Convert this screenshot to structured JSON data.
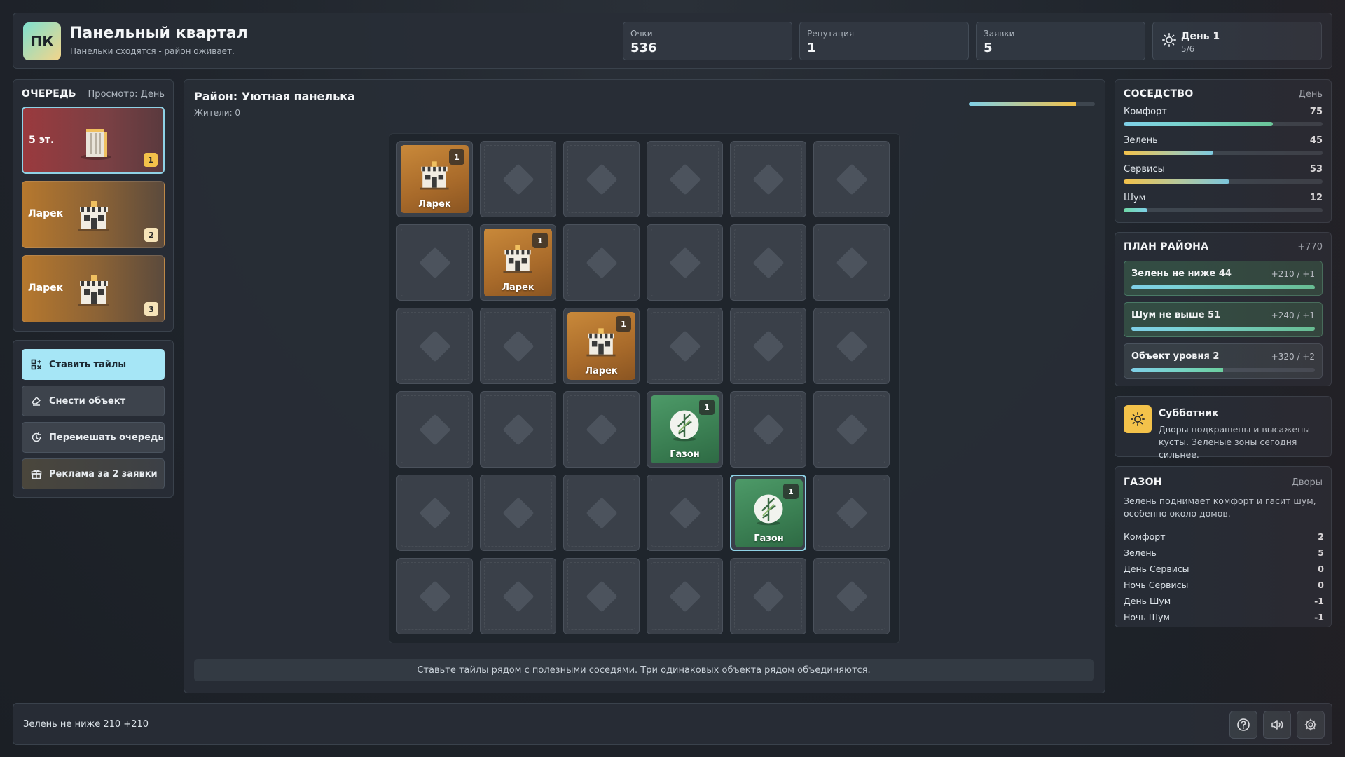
{
  "app": {
    "logo": "ПК",
    "title": "Панельный квартал",
    "subtitle": "Панельки сходятся - район оживает."
  },
  "stats": {
    "score_label": "Очки",
    "score": "536",
    "reputation_label": "Репутация",
    "reputation": "1",
    "requests_label": "Заявки",
    "requests": "5",
    "day_label": "День 1",
    "day_progress": "5/6",
    "day_icon": "sun-icon"
  },
  "queue": {
    "title": "ОЧЕРЕДЬ",
    "view": "Просмотр: День",
    "items": [
      {
        "name": "5 эт.",
        "num": "1",
        "kind": "building"
      },
      {
        "name": "Ларек",
        "num": "2",
        "kind": "kiosk"
      },
      {
        "name": "Ларек",
        "num": "3",
        "kind": "kiosk"
      }
    ]
  },
  "actions": {
    "place": "Ставить тайлы",
    "demolish": "Снести объект",
    "shuffle": "Перемешать очередь",
    "ad": "Реклама за 2 заявки"
  },
  "board": {
    "district": "Район: Уютная панелька",
    "residents": "Жители: 0",
    "top_progress": 0.85,
    "hint": "Ставьте тайлы рядом с полезными соседями. Три одинаковых объекта рядом объединяются.",
    "tiles": [
      {
        "row": 0,
        "col": 0,
        "name": "Ларек",
        "level": "1",
        "kind": "kiosk"
      },
      {
        "row": 1,
        "col": 1,
        "name": "Ларек",
        "level": "1",
        "kind": "kiosk"
      },
      {
        "row": 2,
        "col": 2,
        "name": "Ларек",
        "level": "1",
        "kind": "kiosk"
      },
      {
        "row": 3,
        "col": 3,
        "name": "Газон",
        "level": "1",
        "kind": "lawn"
      },
      {
        "row": 4,
        "col": 4,
        "name": "Газон",
        "level": "1",
        "kind": "lawn",
        "selected": true
      }
    ]
  },
  "neighbors": {
    "title": "СОСЕДСТВО",
    "mode": "День",
    "meters": [
      {
        "label": "Комфорт",
        "value": "75",
        "fill": 0.75,
        "color": "#7fd8c4"
      },
      {
        "label": "Зелень",
        "value": "45",
        "fill": 0.45,
        "color": "#7fd0e8"
      },
      {
        "label": "Сервисы",
        "value": "53",
        "fill": 0.53,
        "color": "#8fd2e6"
      },
      {
        "label": "Шум",
        "value": "12",
        "fill": 0.12,
        "color": "#6fd8a6"
      }
    ]
  },
  "plan": {
    "title": "ПЛАН РАЙОНА",
    "total": "+770",
    "goals": [
      {
        "name": "Зелень не ниже 44",
        "reward": "+210 / +1",
        "progress": 1.0,
        "done": true
      },
      {
        "name": "Шум не выше 51",
        "reward": "+240 / +1",
        "progress": 1.0,
        "done": true
      },
      {
        "name": "Объект уровня 2",
        "reward": "+320 / +2",
        "progress": 0.5,
        "done": false
      }
    ]
  },
  "event": {
    "title": "Субботник",
    "text": "Дворы подкрашены и высажены кусты. Зеленые зоны сегодня сильнее.",
    "icon": "sun-icon"
  },
  "tile_info": {
    "title": "ГАЗОН",
    "category": "Дворы",
    "description": "Зелень поднимает комфорт и гасит шум, особенно около домов.",
    "rows": [
      {
        "label": "Комфорт",
        "value": "2"
      },
      {
        "label": "Зелень",
        "value": "5"
      },
      {
        "label": "День Сервисы",
        "value": "0"
      },
      {
        "label": "Ночь Сервисы",
        "value": "0"
      },
      {
        "label": "День Шум",
        "value": "-1"
      },
      {
        "label": "Ночь Шум",
        "value": "-1"
      }
    ]
  },
  "footer": {
    "status": "Зелень не ниже 210 +210"
  },
  "colors": {
    "accent": "#a6e6f6",
    "kiosk": "#c9893a",
    "lawn": "#4d9a68",
    "badge": "#f3c24a"
  }
}
